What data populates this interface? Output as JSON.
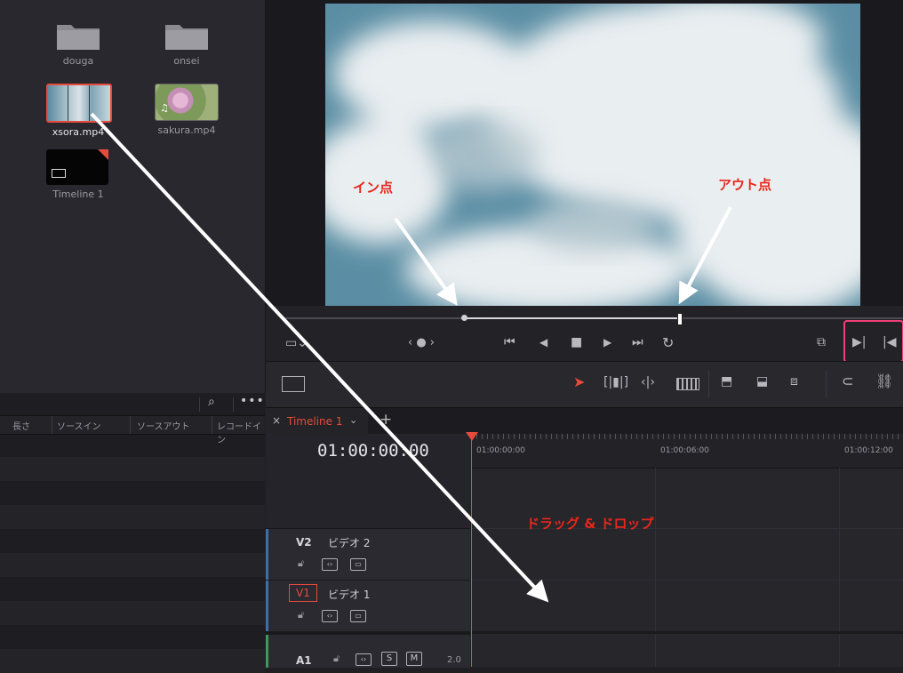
{
  "media_pool": {
    "items": [
      {
        "name": "douga",
        "kind": "folder"
      },
      {
        "name": "onsei",
        "kind": "folder"
      },
      {
        "name": "xsora.mp4",
        "kind": "video",
        "selected": true
      },
      {
        "name": "sakura.mp4",
        "kind": "video"
      },
      {
        "name": "Timeline 1",
        "kind": "timeline"
      }
    ]
  },
  "list": {
    "columns": [
      "長さ",
      "ソースイン",
      "ソースアウト",
      "レコードイン"
    ]
  },
  "annotations": {
    "in_point": "イン点",
    "out_point": "アウト点",
    "drag_drop": "ドラッグ & ドロップ"
  },
  "timeline": {
    "tab_name": "Timeline 1",
    "timecode": "01:00:00:00",
    "ruler": [
      "01:00:00:00",
      "01:00:06:00",
      "01:00:12:00"
    ],
    "tracks": [
      {
        "id": "V2",
        "name": "ビデオ 2"
      },
      {
        "id": "V1",
        "name": "ビデオ 1"
      },
      {
        "id": "A1",
        "name": "",
        "level": "2.0",
        "solo": "S",
        "mute": "M"
      }
    ]
  },
  "colors": {
    "accent": "#e64b3c",
    "highlight": "#f0407a",
    "annotation": "#e8261c"
  }
}
